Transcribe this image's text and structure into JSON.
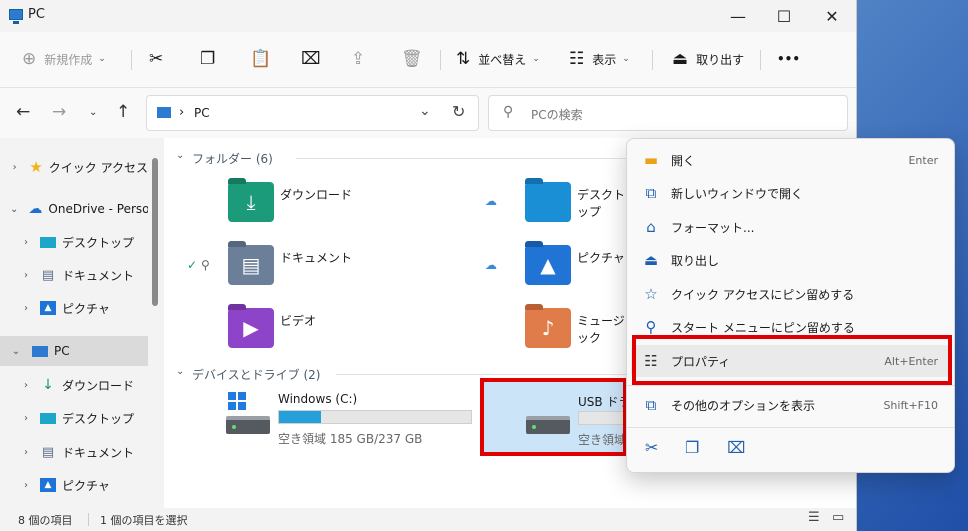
{
  "window": {
    "title": "PC"
  },
  "toolbar": {
    "new_label": "新規作成",
    "sort_label": "並べ替え",
    "view_label": "表示",
    "eject_label": "取り出す",
    "more_label": "•••"
  },
  "address": {
    "crumb": "PC",
    "search_placeholder": "PCの検索"
  },
  "sidebar": {
    "items": [
      {
        "label": "クイック アクセス"
      },
      {
        "label": "OneDrive - Perso"
      },
      {
        "label": "デスクトップ"
      },
      {
        "label": "ドキュメント"
      },
      {
        "label": "ピクチャ"
      },
      {
        "label": "PC"
      },
      {
        "label": "ダウンロード"
      },
      {
        "label": "デスクトップ"
      },
      {
        "label": "ドキュメント"
      },
      {
        "label": "ピクチャ"
      }
    ]
  },
  "content": {
    "folders_group": "フォルダー (6)",
    "folders": [
      {
        "label": "ダウンロード"
      },
      {
        "label": "デスクトップ"
      },
      {
        "label": "ドキュメント"
      },
      {
        "label": "ピクチャ"
      },
      {
        "label": "ビデオ"
      },
      {
        "label": "ミュージック"
      }
    ],
    "drives_group": "デバイスとドライブ (2)",
    "drive_c": {
      "name": "Windows (C:)",
      "info": "空き領域 185 GB/237 GB",
      "used_fraction": 0.22
    },
    "drive_usb": {
      "name": "USB ドライブ",
      "info": "空き領域"
    }
  },
  "statusbar": {
    "count": "8 個の項目",
    "selected": "1 個の項目を選択"
  },
  "context_menu": {
    "items": [
      {
        "label": "開く",
        "shortcut": "Enter"
      },
      {
        "label": "新しいウィンドウで開く",
        "shortcut": ""
      },
      {
        "label": "フォーマット...",
        "shortcut": ""
      },
      {
        "label": "取り出し",
        "shortcut": ""
      },
      {
        "label": "クイック アクセスにピン留めする",
        "shortcut": ""
      },
      {
        "label": "スタート メニューにピン留めする",
        "shortcut": ""
      },
      {
        "label": "プロパティ",
        "shortcut": "Alt+Enter"
      },
      {
        "label": "その他のオプションを表示",
        "shortcut": "Shift+F10"
      }
    ]
  },
  "colors": {
    "highlight_box": "#e00000",
    "selection": "#cce4f7",
    "accent": "#26a0da"
  }
}
